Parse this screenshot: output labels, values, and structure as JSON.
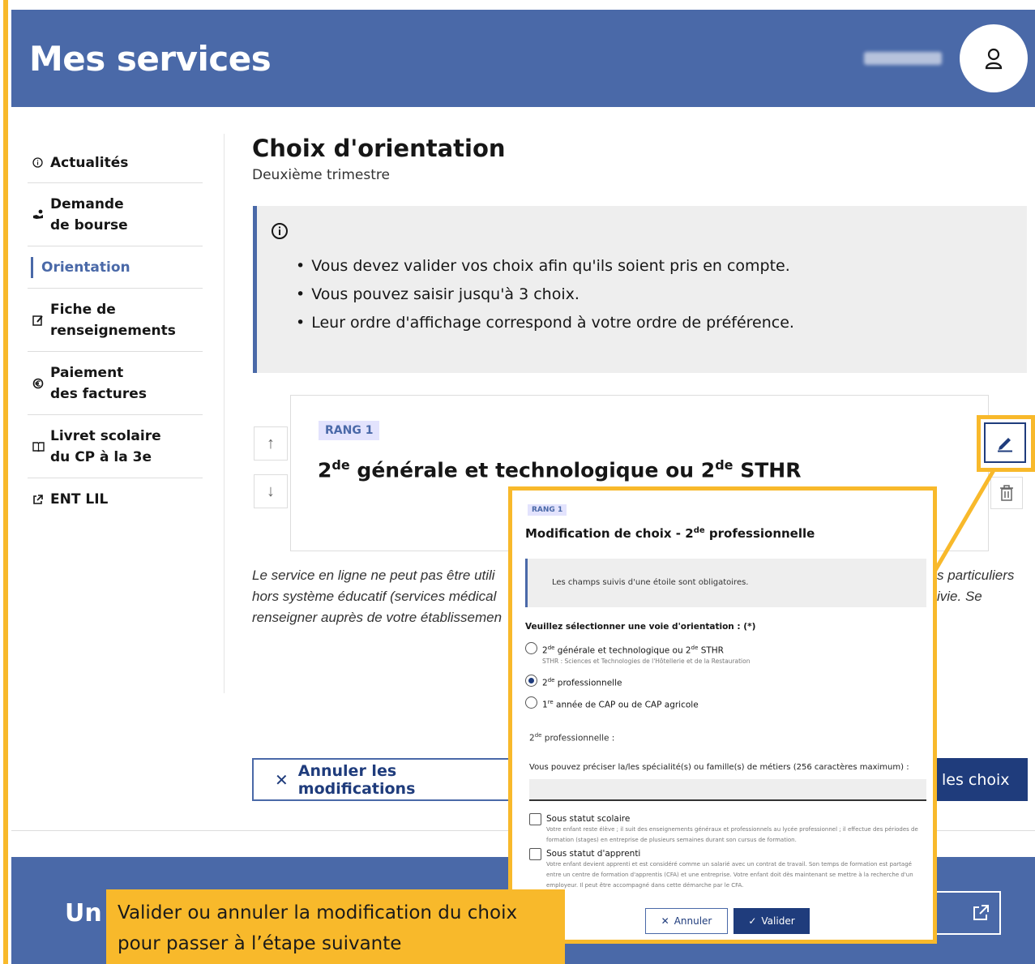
{
  "header": {
    "title": "Mes services"
  },
  "sidebar": {
    "items": [
      {
        "label": "Actualités",
        "icon": "info-circle-icon"
      },
      {
        "label": "Demande de bourse",
        "icon": "hand-coins-icon"
      },
      {
        "label": "Orientation",
        "icon": "",
        "active": true
      },
      {
        "label": "Fiche de renseignements",
        "icon": "edit-form-icon"
      },
      {
        "label": "Paiement des factures",
        "icon": "euro-coin-icon"
      },
      {
        "label": "Livret scolaire du CP à la 3e",
        "icon": "book-open-icon"
      },
      {
        "label": "ENT LIL",
        "icon": "external-link-icon"
      }
    ]
  },
  "main": {
    "title": "Choix d'orientation",
    "subtitle": "Deuxième trimestre",
    "info_items": [
      "Vous devez valider vos choix afin qu'ils soient pris en compte.",
      "Vous pouvez saisir jusqu'à 3 choix.",
      "Leur ordre d'affichage correspond à votre ordre de préférence."
    ],
    "card": {
      "rang": "RANG 1",
      "choice_a": "2",
      "choice_sup1": "de",
      "choice_b": " générale et technologique ou 2",
      "choice_sup2": "de",
      "choice_c": " STHR"
    },
    "notice_left": [
      "Le service en ligne ne peut pas être utili",
      "hors système éducatif (services médical",
      "renseigner auprès de votre établissemen"
    ],
    "notice_right": [
      "s particuliers",
      "ivie. Se",
      ""
    ],
    "cancel_label": "Annuler les modifications",
    "validate_label": "les choix"
  },
  "footer": {
    "text": "Un"
  },
  "modal": {
    "rang": "RANG 1",
    "title_a": "Modification de choix - 2",
    "title_sup": "de",
    "title_b": " professionnelle",
    "info": "Les champs suivis d'une étoile sont obligatoires.",
    "question": "Veuillez sélectionner une voie d'orientation : (*)",
    "options": [
      {
        "a": "2",
        "sup": "de",
        "b": " générale et technologique ou 2",
        "sup2": "de",
        "c": " STHR",
        "hint": "STHR : Sciences et Technologies de l'Hôtellerie et de la Restauration",
        "selected": false
      },
      {
        "a": "2",
        "sup": "de",
        "b": " professionnelle",
        "sup2": "",
        "c": "",
        "hint": "",
        "selected": true
      },
      {
        "a": "1",
        "sup": "re",
        "b": " année de CAP ou de CAP agricole",
        "sup2": "",
        "c": "",
        "hint": "",
        "selected": false
      }
    ],
    "section_a": "2",
    "section_sup": "de",
    "section_b": " professionnelle :",
    "precision_label": "Vous pouvez préciser la/les spécialité(s) ou famille(s) de métiers (256 caractères maximum) :",
    "precision_value": "",
    "statuses": [
      {
        "label": "Sous statut scolaire",
        "hint": "Votre enfant reste élève ; il suit des enseignements généraux et professionnels au lycée professionnel ; il effectue des périodes de formation (stages) en entreprise de plusieurs semaines durant son cursus de formation."
      },
      {
        "label": "Sous statut d'apprenti",
        "hint": "Votre enfant devient apprenti et est considéré comme un salarié avec un contrat de travail. Son temps de formation est partagé entre un centre de formation d'apprentis (CFA) et une entreprise. Votre enfant doit dès maintenant se mettre à la recherche d'un employeur. Il peut être accompagné dans cette démarche par le CFA."
      }
    ],
    "cancel_label": "Annuler",
    "validate_label": "Valider"
  },
  "callout": {
    "line1": "Valider ou annuler la modification du choix",
    "line2": "pour passer à l’étape suivante"
  },
  "colors": {
    "primary": "#4a69a8",
    "dark_blue": "#1f3c7c",
    "highlight": "#f8b92b",
    "info_bg": "#eeeeee"
  }
}
